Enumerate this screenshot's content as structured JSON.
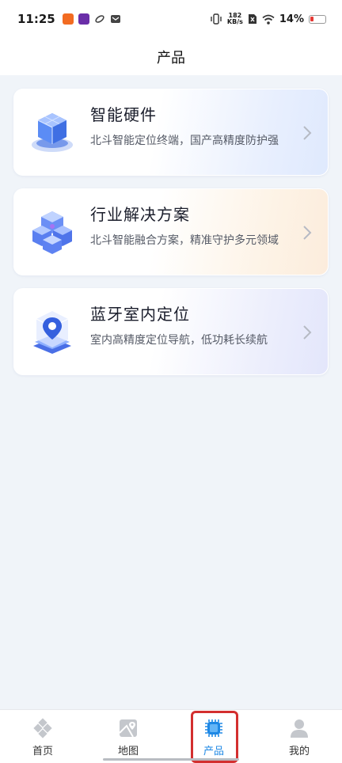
{
  "status_bar": {
    "time": "11:25",
    "net_speed": "182",
    "net_unit": "KB/s",
    "battery": "14%",
    "icons": [
      "app-notification-icon",
      "app-notification-icon",
      "sync-icon",
      "mail-icon",
      "vibrate-icon",
      "wifi-icon",
      "battery-icon"
    ]
  },
  "header": {
    "title": "产品"
  },
  "products": [
    {
      "title": "智能硬件",
      "description": "北斗智能定位终端，国产高精度防护强",
      "icon": "hardware-cube-icon",
      "accent": "#dfe9fd"
    },
    {
      "title": "行业解决方案",
      "description": "北斗智能融合方案，精准守护多元领域",
      "icon": "solution-blocks-icon",
      "accent": "#fcecdc"
    },
    {
      "title": "蓝牙室内定位",
      "description": "室内高精度定位导航，低功耗长续航",
      "icon": "indoor-location-icon",
      "accent": "#e3e6fb"
    }
  ],
  "tab_bar": {
    "active_color": "#1e88e5",
    "tabs": [
      {
        "label": "首页",
        "icon": "home-diamond-icon"
      },
      {
        "label": "地图",
        "icon": "map-icon"
      },
      {
        "label": "产品",
        "icon": "chip-icon",
        "active": true
      },
      {
        "label": "我的",
        "icon": "person-icon"
      }
    ]
  }
}
